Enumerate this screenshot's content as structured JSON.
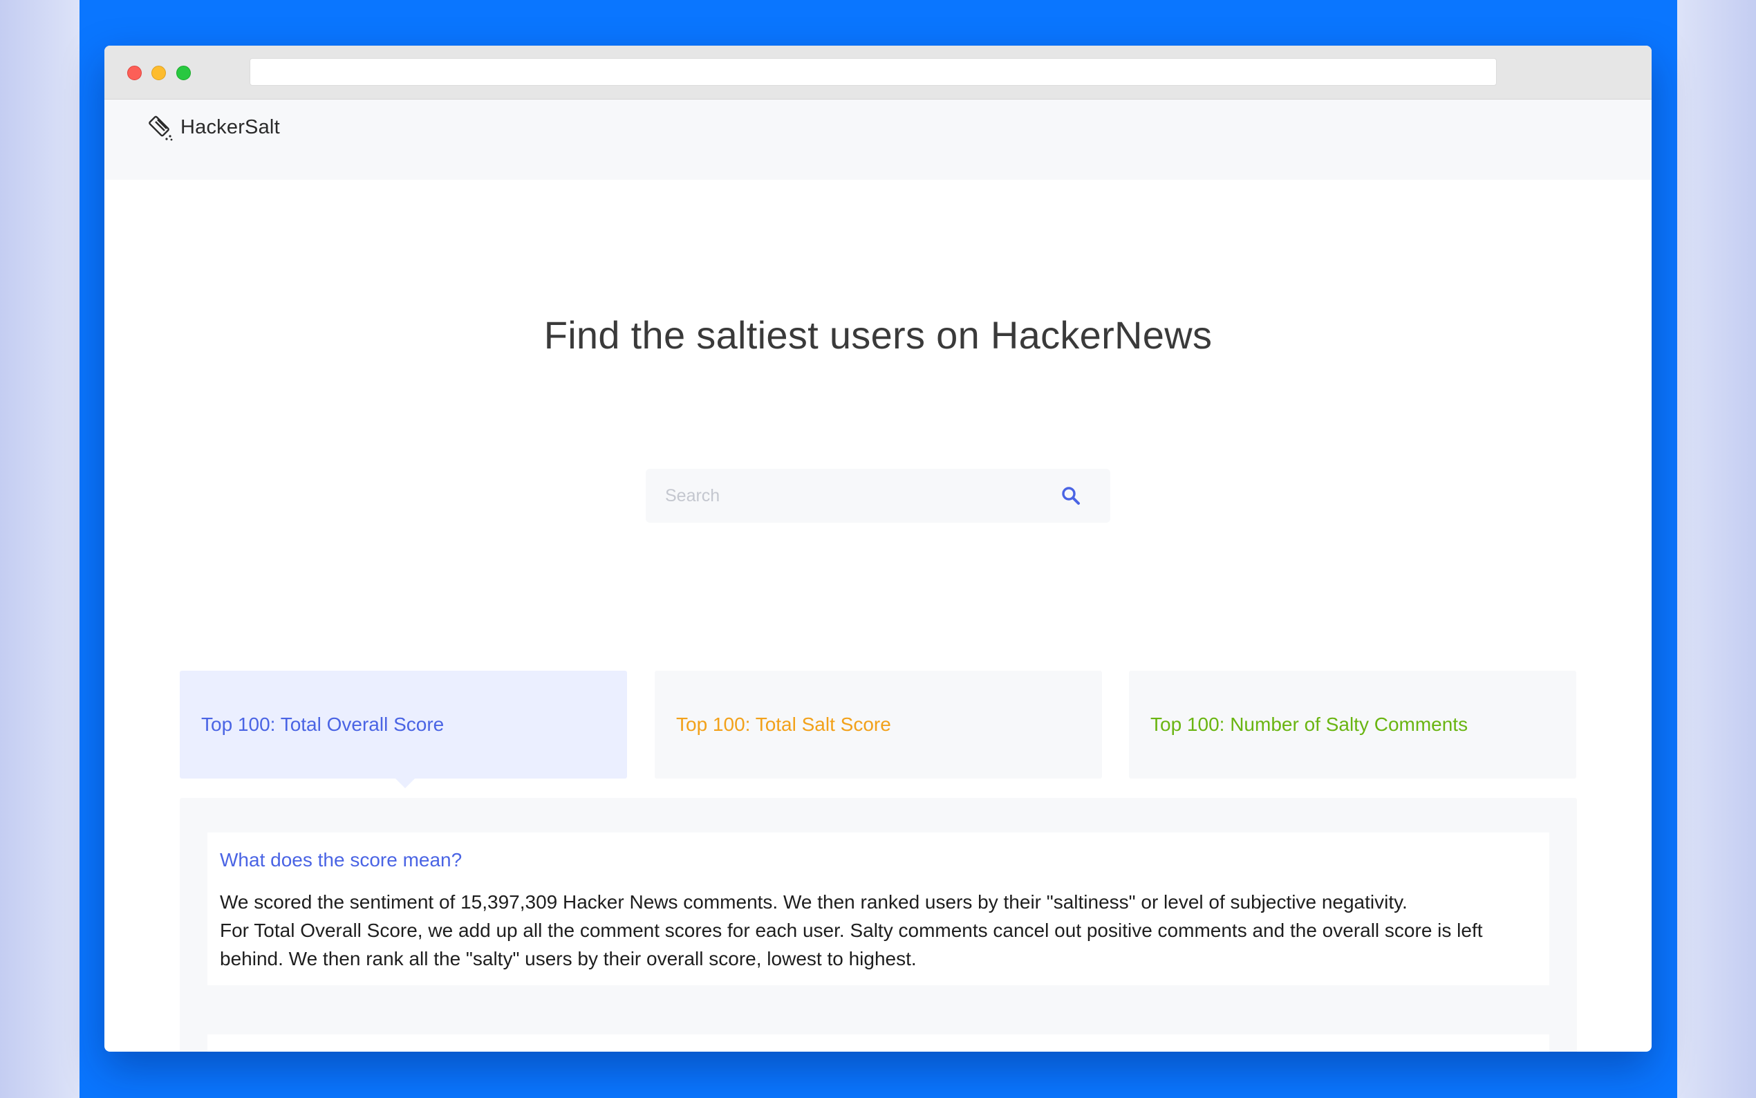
{
  "app": {
    "brand_name": "HackerSalt",
    "logo_icon": "salt-shaker-icon"
  },
  "browser": {
    "url": ""
  },
  "hero": {
    "title": "Find the saltiest users on HackerNews"
  },
  "search": {
    "placeholder": "Search",
    "value": "",
    "icon": "search-icon"
  },
  "tabs": [
    {
      "label": "Top 100: Total Overall Score",
      "color": "#4a64e4",
      "active": true
    },
    {
      "label": "Top 100: Total Salt Score",
      "color": "#f2a11a",
      "active": false
    },
    {
      "label": "Top 100: Number of Salty Comments",
      "color": "#6ab512",
      "active": false
    }
  ],
  "info": {
    "title": "What does the score mean?",
    "line1": "We scored the sentiment of 15,397,309 Hacker News comments. We then ranked users by their \"saltiness\" or level of subjective negativity.",
    "line2": "For Total Overall Score, we add up all the comment scores for each user. Salty comments cancel out positive comments and the overall score is left behind. We then rank all the \"salty\" users by their overall score, lowest to highest."
  },
  "colors": {
    "background_blue": "#0a76ff",
    "accent_blue": "#4a64e4",
    "accent_orange": "#f2a11a",
    "accent_green": "#6ab512"
  }
}
